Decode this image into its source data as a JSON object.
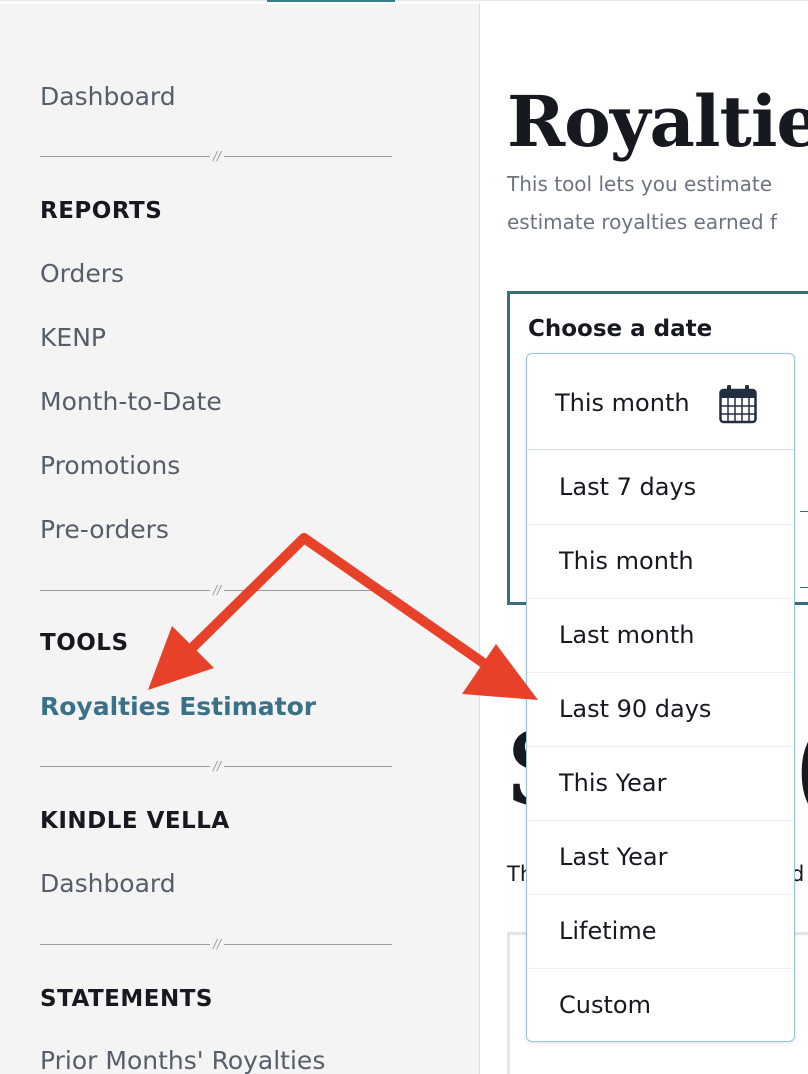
{
  "sidebar": {
    "dashboard": "Dashboard",
    "reports_heading": "REPORTS",
    "reports": [
      "Orders",
      "KENP",
      "Month-to-Date",
      "Promotions",
      "Pre-orders"
    ],
    "tools_heading": "TOOLS",
    "tools": [
      "Royalties Estimator"
    ],
    "vella_heading": "KINDLE VELLA",
    "vella": [
      "Dashboard"
    ],
    "statements_heading": "STATEMENTS",
    "statements": [
      "Prior Months' Royalties"
    ]
  },
  "main": {
    "title": "Royalties",
    "intro_line1": "This tool lets you estimate",
    "intro_line2": "estimate royalties earned f",
    "date_label": "Choose a date",
    "big_symbol": "$",
    "big_paren": "(",
    "fragment_left": "Th",
    "fragment_right": "d"
  },
  "date_dropdown": {
    "selected": "This month",
    "options": [
      "Last 7 days",
      "This month",
      "Last month",
      "Last 90 days",
      "This Year",
      "Last Year",
      "Lifetime",
      "Custom"
    ]
  },
  "colors": {
    "accent_teal": "#3b7187",
    "panel_border": "#3b6e7d",
    "annotation_arrow": "#e8412a",
    "sidebar_bg": "#f4f4f4"
  },
  "icons": {
    "calendar": "calendar-icon",
    "divider": "divider-break-mark"
  }
}
